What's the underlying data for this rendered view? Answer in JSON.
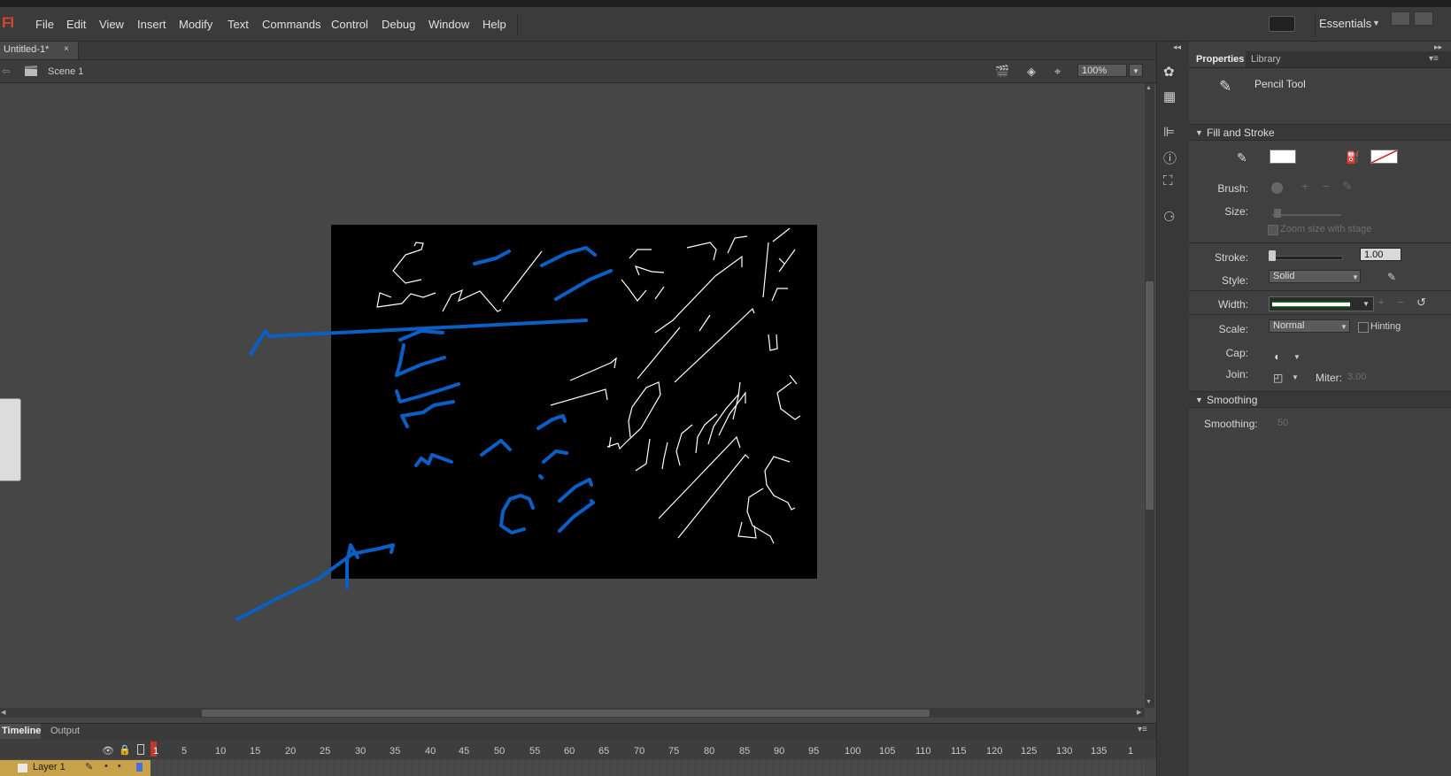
{
  "app": {
    "logo": "Fl"
  },
  "menu": [
    "File",
    "Edit",
    "View",
    "Insert",
    "Modify",
    "Text",
    "Commands",
    "Control",
    "Debug",
    "Window",
    "Help"
  ],
  "workspace": {
    "label": "Essentials"
  },
  "document": {
    "tab_label": "Untitled-1*",
    "close_glyph": "×"
  },
  "scene": {
    "label": "Scene 1",
    "zoom": "100%"
  },
  "timeline": {
    "tabs": [
      "Timeline",
      "Output"
    ],
    "frame_numbers": [
      "1",
      "5",
      "10",
      "15",
      "20",
      "25",
      "30",
      "35",
      "40",
      "45",
      "50",
      "55",
      "60",
      "65",
      "70",
      "75",
      "80",
      "85",
      "90",
      "95",
      "100",
      "105",
      "110",
      "115",
      "120",
      "125",
      "130",
      "135",
      "1"
    ],
    "current_frame": "1",
    "layer": {
      "name": "Layer 1"
    }
  },
  "properties": {
    "tabs": [
      "Properties",
      "Library"
    ],
    "tool_name": "Pencil Tool",
    "fill_and_stroke": {
      "header": "Fill and Stroke",
      "brush_label": "Brush:",
      "size_label": "Size:",
      "zoom_size_label": "Zoom size with stage",
      "stroke_label": "Stroke:",
      "stroke_value": "1.00",
      "stroke_fraction": 0.0,
      "style_label": "Style:",
      "style_value": "Solid",
      "width_label": "Width:",
      "scale_label": "Scale:",
      "scale_value": "Normal",
      "hinting_label": "Hinting",
      "cap_label": "Cap:",
      "join_label": "Join:",
      "miter_label": "Miter:",
      "miter_value": "3.00"
    },
    "smoothing": {
      "header": "Smoothing",
      "label": "Smoothing:",
      "value": "50"
    }
  },
  "colors": {
    "stage": "#000000",
    "stroke_white": "#ffffff",
    "blue_ink": "#0a5fc4",
    "layer_highlight": "#c8a24a",
    "playhead": "#c0392b"
  },
  "icons": [
    "palette-icon",
    "grid-icon",
    "align-icon",
    "info-icon",
    "transform-icon",
    "components-icon",
    "pencil-icon",
    "paint-bucket-icon",
    "eye-icon",
    "lock-icon",
    "clapboard-icon"
  ]
}
